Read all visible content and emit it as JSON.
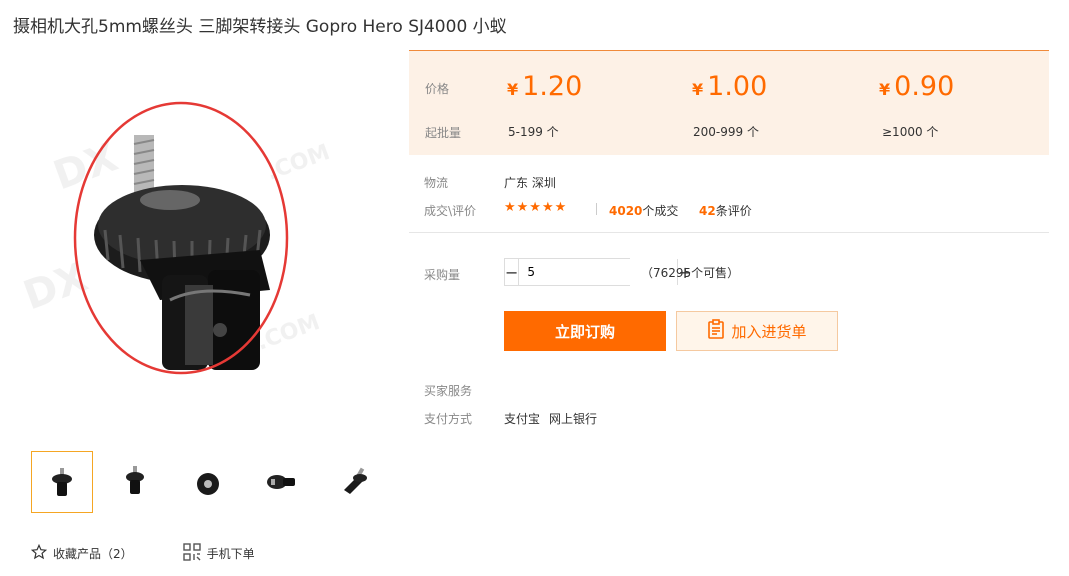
{
  "product": {
    "title": "摄相机大孔5mm螺丝头 三脚架转接头 Gopro Hero SJ4000 小蚁"
  },
  "price_box": {
    "price_label": "价格",
    "moq_label": "起批量",
    "tiers": [
      {
        "currency": "¥",
        "price": "1.20",
        "range": "5-199 个"
      },
      {
        "currency": "¥",
        "price": "1.00",
        "range": "200-999 个"
      },
      {
        "currency": "¥",
        "price": "0.90",
        "range": "≥1000 个"
      }
    ]
  },
  "logistics": {
    "label": "物流",
    "value": "广东 深圳"
  },
  "deals": {
    "label": "成交\\评价",
    "stars": "★★★★★",
    "deal_count": "4020",
    "deal_suffix": "个成交",
    "review_count": "42",
    "review_suffix": "条评价"
  },
  "purchase": {
    "label": "采购量",
    "minus": "−",
    "plus": "+",
    "quantity": "5",
    "stock": "（76295个可售）"
  },
  "buttons": {
    "buy": "立即订购",
    "add_to_list": "加入进货单"
  },
  "services": {
    "buyer_service_label": "买家服务",
    "payment_label": "支付方式",
    "payment_methods": [
      "支付宝",
      "网上银行"
    ]
  },
  "left_actions": {
    "favorite": "收藏产品（2）",
    "mobile_order": "手机下单"
  },
  "colors": {
    "accent": "#ff6a00",
    "price_bg": "#fdf1e6",
    "circle": "#e53935"
  },
  "icons": [
    "star-outline-icon",
    "qr-code-icon",
    "clipboard-icon"
  ]
}
